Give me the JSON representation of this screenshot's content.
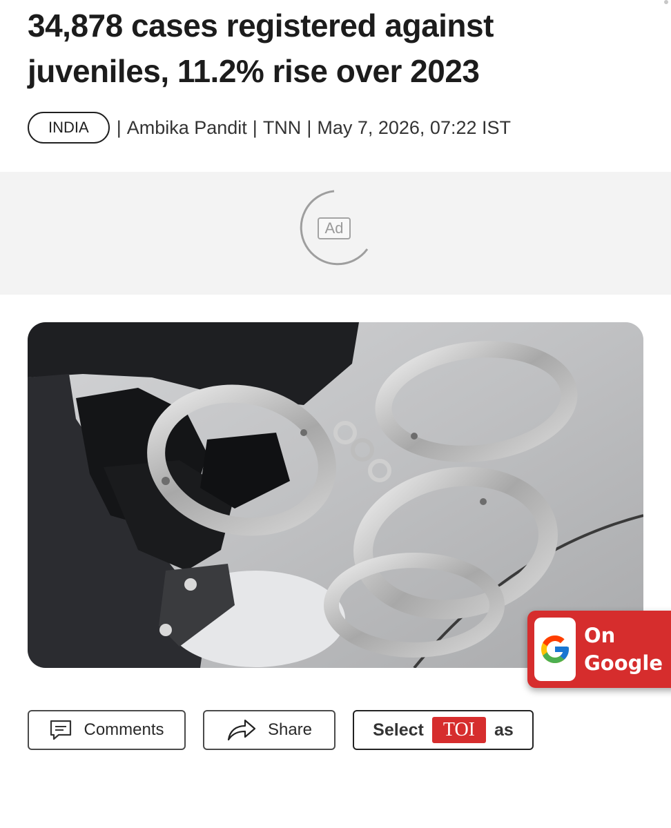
{
  "article": {
    "headline": "34,878 cases registered against juveniles, 11.2% rise over 2023",
    "section": "INDIA",
    "separator": "|",
    "author": "Ambika Pandit",
    "source": "TNN",
    "dateline": "May 7, 2026, 07:22 IST"
  },
  "ad": {
    "label": "Ad"
  },
  "hero_image": {
    "subject": "handcuffs-photo"
  },
  "google_badge": {
    "line1": "On",
    "line2": "Google"
  },
  "actions": {
    "comments": "Comments",
    "share": "Share",
    "select_prefix": "Select",
    "select_brand": "TOI",
    "select_suffix": "as"
  },
  "colors": {
    "brand_red": "#d62d2d",
    "ad_background": "#f3f3f3",
    "text_dark": "#1c1c1c"
  },
  "icons": [
    "comment-icon",
    "share-arrow-icon",
    "google-g-icon",
    "ad-loading-spinner"
  ]
}
